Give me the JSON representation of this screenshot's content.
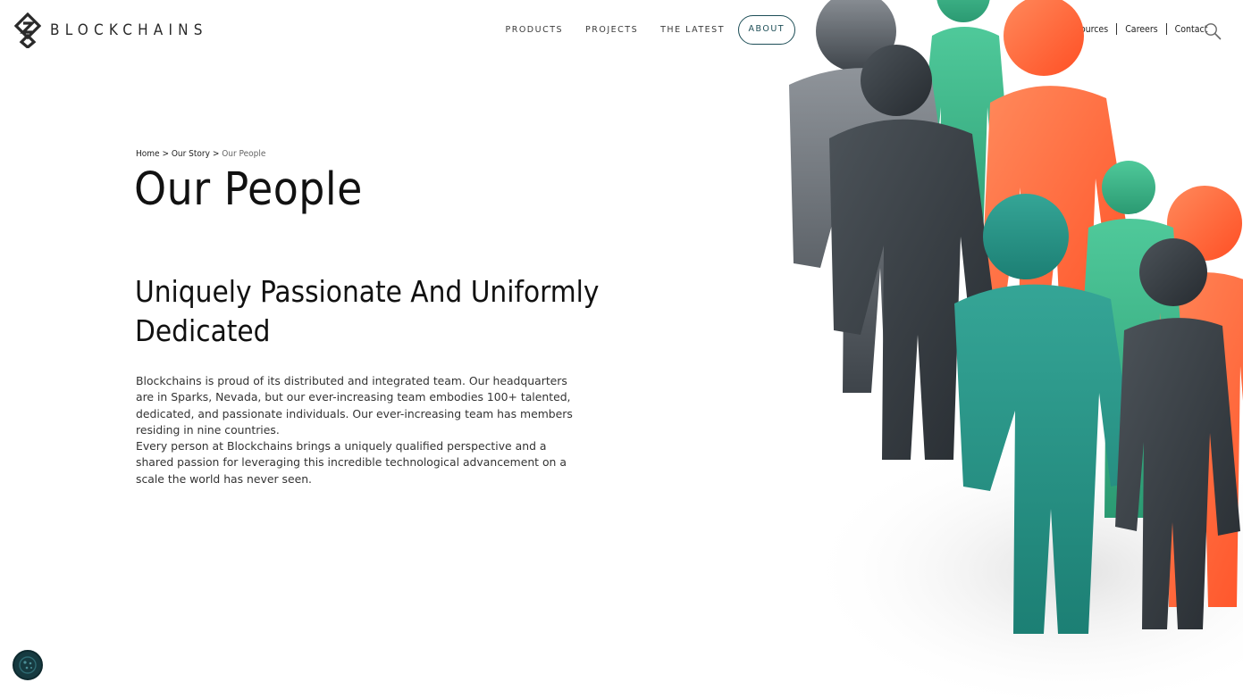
{
  "brand": {
    "name": "BLOCKCHAINS",
    "logo_icon": "blockchains-s-logo"
  },
  "main_nav": {
    "items": [
      {
        "label": "PRODUCTS"
      },
      {
        "label": "PROJECTS"
      },
      {
        "label": "THE LATEST"
      },
      {
        "label": "ABOUT",
        "active": true
      }
    ]
  },
  "util_nav": {
    "items": [
      {
        "label": "Resources"
      },
      {
        "label": "Careers"
      },
      {
        "label": "Contact"
      }
    ],
    "search_icon": "search-icon"
  },
  "breadcrumb": {
    "items": [
      {
        "label": "Home"
      },
      {
        "label": "Our Story"
      },
      {
        "label": "Our People"
      }
    ],
    "separator": ">"
  },
  "page": {
    "title": "Our People",
    "section_heading": "Uniquely Passionate And Uniformly Dedicated",
    "paragraphs": [
      "Blockchains is proud of its distributed and integrated team. Our headquarters are in Sparks, Nevada, but our ever-increasing team embodies 100+ talented, dedicated, and passionate individuals. Our ever-increasing team has members residing in nine countries.",
      "Every person at Blockchains brings a uniquely qualified perspective and a shared passion for leveraging this incredible technological advancement on a scale the world has never seen."
    ]
  },
  "colors": {
    "accent": "#1d4e57",
    "figure_gray": "#5b6066",
    "figure_dark": "#2f353b",
    "figure_orange": "#ff6a3d",
    "figure_teal": "#2a9a8c",
    "figure_green": "#39b88d"
  },
  "cookie_badge_icon": "cookie-settings-icon"
}
